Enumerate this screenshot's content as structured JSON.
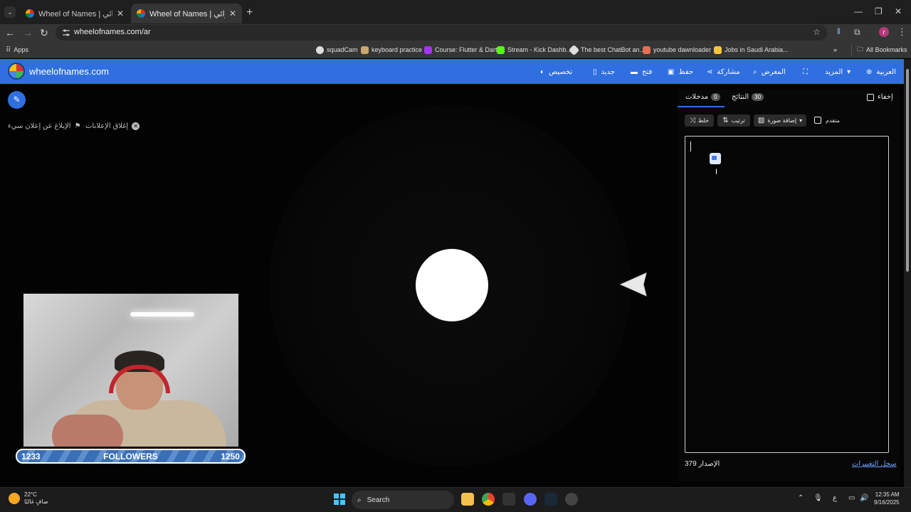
{
  "browser": {
    "tabs": [
      {
        "title": "Wheel of Names | عجلة الاسم العشوائي"
      },
      {
        "title": "Wheel of Names | عجلة الاسم العشوائي"
      }
    ],
    "url": "wheelofnames.com/ar",
    "bookmarks": [
      {
        "label": "Apps"
      },
      {
        "label": "squadCam"
      },
      {
        "label": "keyboard practice"
      },
      {
        "label": "Course: Flutter & Dart"
      },
      {
        "label": "Stream - Kick Dashb..."
      },
      {
        "label": "The best ChatBot an..."
      },
      {
        "label": "youtube dawnloader"
      },
      {
        "label": "Jobs in Saudi Arabia..."
      },
      {
        "label": "All Bookmarks"
      }
    ],
    "profile_initial": "r"
  },
  "site": {
    "title": "wheelofnames.com",
    "menu": {
      "language": "العربية",
      "more": "المزيد",
      "gallery": "المعرض",
      "share": "مشاركة",
      "save": "حفظ",
      "open": "فتح",
      "new": "جديد",
      "customize": "تخصيص"
    },
    "ads": {
      "close_ads": "إغلاق الإعلانات",
      "report_ad": "الإبلاغ عن إعلان سيء"
    }
  },
  "panel": {
    "hide_label": "إخفاء",
    "tabs": [
      {
        "label": "مدخلات",
        "count": "0"
      },
      {
        "label": "النتائج",
        "count": "30"
      }
    ],
    "buttons": {
      "shuffle": "خلط",
      "sort": "ترتيب",
      "add_image": "إضافة صورة",
      "advanced": "متقدم"
    },
    "version_label": "الإصدار 379",
    "changelog_label": "سجل التغييرات"
  },
  "stream_overlay": {
    "followers_label": "FOLLOWERS",
    "followers_current": "1233",
    "followers_goal": "1250"
  },
  "taskbar": {
    "temperature": "22°C",
    "weather_text": "صافٍ غالبًا",
    "search_label": "Search",
    "time": "12:35 AM",
    "date": "9/16/2025",
    "ime": "ع"
  }
}
